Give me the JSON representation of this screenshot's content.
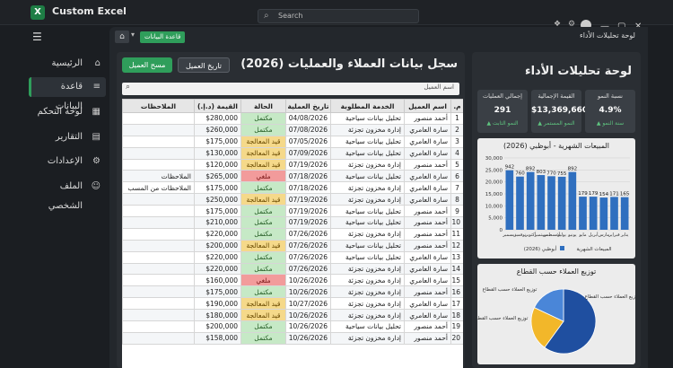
{
  "app": {
    "title": "Custom Excel",
    "logo": "X",
    "search_placeholder": "Search"
  },
  "sidebar": {
    "items": [
      {
        "label": "الرئيسية",
        "icon": "home-icon"
      },
      {
        "label": "قاعدة البيانات",
        "icon": "database-icon"
      },
      {
        "label": "لوحة التحكم",
        "icon": "grid-icon"
      },
      {
        "label": "التقارير",
        "icon": "document-icon"
      },
      {
        "label": "الإعدادات",
        "icon": "gear-icon"
      },
      {
        "label": "الملف الشخصي",
        "icon": "user-icon"
      }
    ]
  },
  "breadcrumb": {
    "current": "قاعدة البيانات"
  },
  "header_right": "لوحة تحليلات الأداء",
  "data_panel": {
    "title": "سجل بيانات العملاء والعمليات (2026)",
    "add_button": "مسح العميل",
    "history_button": "تاريخ العميل",
    "search_placeholder": "اسم العميل",
    "columns": [
      "م.",
      "اسم العميل",
      "الخدمة المطلوبة",
      "تاريخ العملية",
      "الحالة",
      "القيمة (د.إ.)",
      "الملاحظات"
    ],
    "rows": [
      [
        "1",
        "أحمد منصور",
        "تحليل بيانات سياحية",
        "04/08/2026",
        "مكتمل",
        "$280,000",
        ""
      ],
      [
        "2",
        "سارة العامري",
        "إدارة مخزون تجزئة",
        "07/08/2026",
        "مكتمل",
        "$260,000",
        ""
      ],
      [
        "3",
        "سارة العامري",
        "تحليل بيانات سياحية",
        "07/05/2026",
        "قيد المعالجة",
        "$175,000",
        ""
      ],
      [
        "4",
        "سارة العامري",
        "تحليل بيانات سياحية",
        "07/09/2026",
        "قيد المعالجة",
        "$130,000",
        ""
      ],
      [
        "5",
        "أحمد منصور",
        "إدارة مخزون تجزئة",
        "07/19/2026",
        "قيد المعالجة",
        "$120,000",
        ""
      ],
      [
        "6",
        "سارة العامري",
        "تحليل بيانات سياحية",
        "07/18/2026",
        "ملغي",
        "$265,000",
        "الملاحظات"
      ],
      [
        "7",
        "سارة العامري",
        "إدارة مخزون تجزئة",
        "07/18/2026",
        "مكتمل",
        "$175,000",
        "الملاحظات من المسب"
      ],
      [
        "8",
        "سارة العامري",
        "إدارة مخزون تجزئة",
        "07/19/2026",
        "قيد المعالجة",
        "$250,000",
        ""
      ],
      [
        "9",
        "أحمد منصور",
        "تحليل بيانات سياحية",
        "07/19/2026",
        "مكتمل",
        "$175,000",
        ""
      ],
      [
        "10",
        "أحمد منصور",
        "تحليل بيانات سياحية",
        "07/19/2026",
        "مكتمل",
        "$210,000",
        ""
      ],
      [
        "11",
        "أحمد منصور",
        "إدارة مخزون تجزئة",
        "07/26/2026",
        "مكتمل",
        "$220,000",
        ""
      ],
      [
        "12",
        "أحمد منصور",
        "تحليل بيانات سياحية",
        "07/26/2026",
        "قيد المعالجة",
        "$200,000",
        ""
      ],
      [
        "13",
        "سارة العامري",
        "تحليل بيانات سياحية",
        "07/26/2026",
        "مكتمل",
        "$220,000",
        ""
      ],
      [
        "14",
        "سارة العامري",
        "إدارة مخزون تجزئة",
        "07/26/2026",
        "مكتمل",
        "$220,000",
        ""
      ],
      [
        "15",
        "سارة العامري",
        "إدارة مخزون تجزئة",
        "10/26/2026",
        "ملغي",
        "$160,000",
        ""
      ],
      [
        "16",
        "أحمد منصور",
        "إدارة مخزون تجزئة",
        "10/26/2026",
        "مكتمل",
        "$175,000",
        ""
      ],
      [
        "17",
        "سارة العامري",
        "إدارة مخزون تجزئة",
        "10/27/2026",
        "قيد المعالجة",
        "$190,000",
        ""
      ],
      [
        "18",
        "سارة العامري",
        "إدارة مخزون تجزئة",
        "10/26/2026",
        "قيد المعالجة",
        "$180,000",
        ""
      ],
      [
        "19",
        "أحمد منصور",
        "تحليل بيانات سياحية",
        "10/26/2026",
        "مكتمل",
        "$200,000",
        ""
      ],
      [
        "20",
        "أحمد منصور",
        "إدارة مخزون تجزئة",
        "10/26/2026",
        "مكتمل",
        "$158,000",
        ""
      ]
    ]
  },
  "dashboard": {
    "title": "لوحة تحليلات الأداء",
    "kpis": [
      {
        "label": "إجمالي العمليات",
        "value": "291",
        "sub": "النمو الثابت ▲"
      },
      {
        "label": "القيمة الإجمالية",
        "value": "$13,369,660",
        "sub": "النمو المستمر ▲"
      },
      {
        "label": "نسبة النمو",
        "value": "4.9%",
        "sub": "سنة النمو ▲"
      }
    ]
  },
  "chart_data": [
    {
      "type": "bar",
      "title": "المبيعات الشهرية - أبوظبي (2026)",
      "categories": [
        "يناير",
        "فبراير",
        "مارس",
        "أبريل",
        "مايو",
        "يونيو",
        "يوليو",
        "أغسطس",
        "سبتمبر",
        "أكتوبر",
        "نوفمبر",
        "ديسمبر"
      ],
      "series": [
        {
          "name": "المبيعات الشهرية",
          "values": [
            165,
            171,
            154,
            179,
            179,
            892,
            755,
            770,
            803,
            892,
            760,
            942
          ]
        }
      ],
      "ylim": [
        0,
        30000
      ],
      "yticks": [
        "0",
        "5,000",
        "10,000",
        "15,000",
        "20,000",
        "25,000",
        "30,000"
      ],
      "legend": [
        "المبيعات الشهرية",
        "(2026) أبوظبي"
      ],
      "colors": [
        "#2f6fbf"
      ]
    },
    {
      "type": "pie",
      "title": "توزيع العملاء حسب القطاع",
      "slices": [
        {
          "label": "توزيع العملاء حسب القطاع",
          "value": 60,
          "color": "#1f4fa0"
        },
        {
          "label": "توزيع العملاء حسب القطاع",
          "value": 22,
          "color": "#f2b72a"
        },
        {
          "label": "توزيع العملاء حسب القطاع",
          "value": 18,
          "color": "#4a86d8"
        }
      ]
    }
  ]
}
